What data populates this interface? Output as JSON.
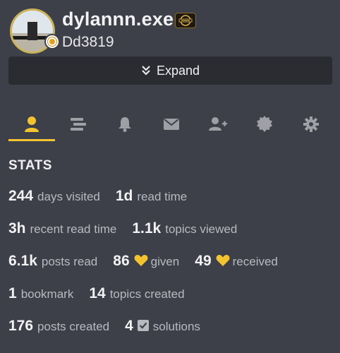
{
  "profile": {
    "username": "dylannn.exe",
    "display_name": "Dd3819",
    "flair_text": "DEVFORUM"
  },
  "expand": {
    "label": "Expand"
  },
  "tabs": [
    {
      "name": "summary",
      "icon": "user-icon",
      "active": true
    },
    {
      "name": "activity",
      "icon": "stream-icon"
    },
    {
      "name": "notifications",
      "icon": "bell-icon"
    },
    {
      "name": "messages",
      "icon": "envelope-icon"
    },
    {
      "name": "invites",
      "icon": "user-plus-icon"
    },
    {
      "name": "badges",
      "icon": "certificate-icon"
    },
    {
      "name": "preferences",
      "icon": "cog-icon"
    }
  ],
  "stats": {
    "title": "STATS",
    "days_visited": {
      "value": "244",
      "label": "days visited"
    },
    "read_time": {
      "value": "1d",
      "label": "read time"
    },
    "recent_read_time": {
      "value": "3h",
      "label": "recent read time"
    },
    "topics_viewed": {
      "value": "1.1k",
      "label": "topics viewed"
    },
    "posts_read": {
      "value": "6.1k",
      "label": "posts read"
    },
    "likes_given": {
      "value": "86",
      "label": "given"
    },
    "likes_received": {
      "value": "49",
      "label": "received"
    },
    "bookmarks": {
      "value": "1",
      "label": "bookmark"
    },
    "topics_created": {
      "value": "14",
      "label": "topics created"
    },
    "posts_created": {
      "value": "176",
      "label": "posts created"
    },
    "solutions": {
      "value": "4",
      "label": "solutions"
    }
  },
  "colors": {
    "background": "#3d4048",
    "accent": "#f4c430",
    "button_bg": "#2a2c31",
    "icon": "#9ea0a6"
  }
}
